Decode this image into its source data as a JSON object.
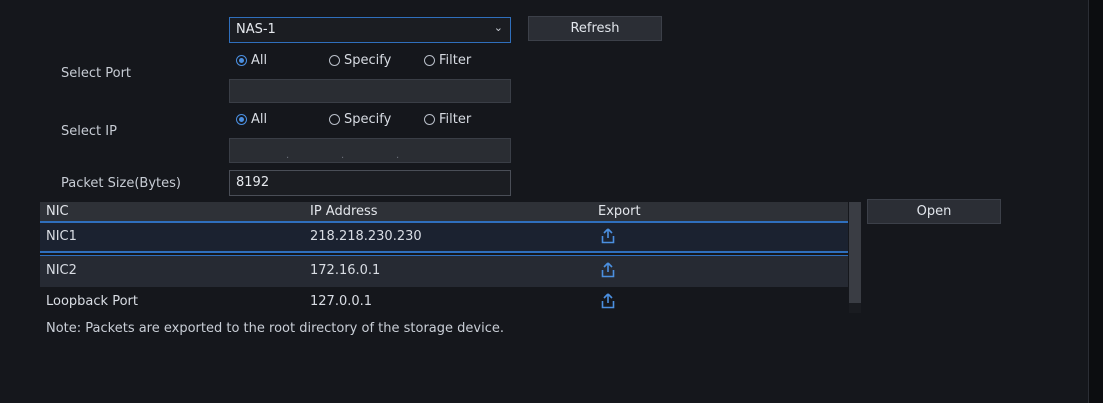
{
  "device_select": {
    "value": "NAS-1",
    "chevron_icon": "chevron-down-icon"
  },
  "refresh_label": "Refresh",
  "select_port": {
    "label": "Select Port",
    "options": [
      "All",
      "Specify",
      "Filter"
    ],
    "selected": "All",
    "value": ""
  },
  "select_ip": {
    "label": "Select IP",
    "options": [
      "All",
      "Specify",
      "Filter"
    ],
    "selected": "All",
    "value": [
      "",
      "",
      "",
      ""
    ]
  },
  "packet_size": {
    "label": "Packet Size(Bytes)",
    "value": "8192"
  },
  "open_label": "Open",
  "table": {
    "headers": [
      "NIC",
      "IP Address",
      "Export"
    ],
    "rows": [
      {
        "nic": "NIC1",
        "ip": "218.218.230.230",
        "export_icon": "export-icon"
      },
      {
        "nic": "NIC2",
        "ip": "172.16.0.1",
        "export_icon": "export-icon"
      },
      {
        "nic": "Loopback Port",
        "ip": "127.0.0.1",
        "export_icon": "export-icon"
      }
    ]
  },
  "note": "Note: Packets are exported to the root directory of the storage device.",
  "colors": {
    "accent": "#2f6fbd",
    "icon_blue": "#4b8fe0",
    "background": "#15171c"
  }
}
